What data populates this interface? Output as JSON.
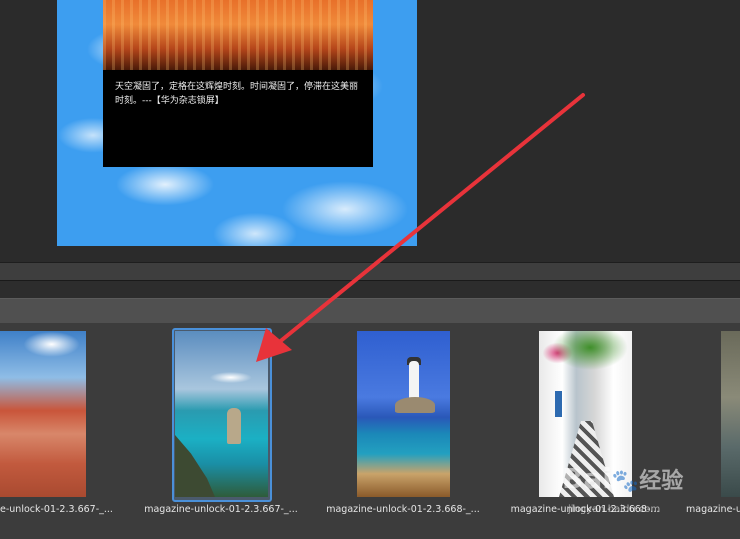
{
  "preview": {
    "caption": "天空凝固了，定格在这辉煌时刻。时间凝固了，停滞在这美丽时刻。---【华为杂志锁屏】"
  },
  "filmstrip": {
    "thumbnails": [
      {
        "label": "e-unlock-01-2.3.667-_...",
        "scene": "red desert canyon road",
        "selected": false
      },
      {
        "label": "magazine-unlock-01-2.3.667-_...",
        "scene": "sea stack and turquoise ocean",
        "selected": true
      },
      {
        "label": "magazine-unlock-01-2.3.668-_...",
        "scene": "lighthouse on rocky islet",
        "selected": false
      },
      {
        "label": "magazine-unlock-01-2.3.668-...",
        "scene": "white alley with flowers",
        "selected": false
      },
      {
        "label": "magazine-u...",
        "scene": "partial thumbnail",
        "selected": false
      }
    ]
  },
  "annotation": {
    "arrow_color": "#e8333a"
  },
  "watermark": {
    "brand": "Bai",
    "brand_suffix": "经验",
    "url": "jingyan.baidu.com"
  },
  "colors": {
    "selection": "#4a90d9",
    "panel_bg": "#3c3c3c"
  }
}
